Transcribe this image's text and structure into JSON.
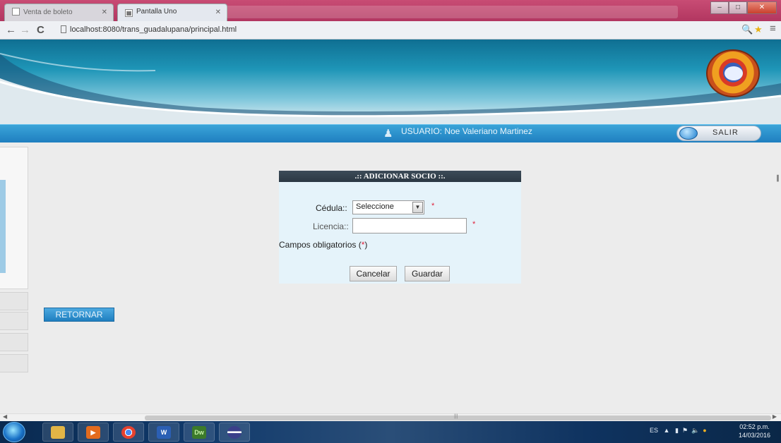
{
  "browser": {
    "tabs": [
      {
        "label": "Venta de boleto",
        "active": false
      },
      {
        "label": "Pantalla Uno",
        "active": true
      }
    ],
    "address": "localhost:8080/trans_guadalupana/principal.html",
    "nav": {
      "back": "←",
      "forward": "→",
      "reload": "C"
    },
    "tools": {
      "zoom": "🔍",
      "bookmark": "★",
      "menu": "≡"
    },
    "window": {
      "minimize": "–",
      "maximize": "□",
      "close": "✕"
    }
  },
  "userbar": {
    "text": "USUARIO:  Noe Valeriano Martinez",
    "logout_label": "SALIR"
  },
  "form": {
    "title": ".:: ADICIONAR SOCIO ::.",
    "cedula_label": "Cédula::",
    "cedula_value": "Seleccione",
    "licencia_label": "Licencia::",
    "licencia_value": "",
    "required_mark": "*",
    "required_note_prefix": "Campos obligatorios (",
    "required_note_suffix": ")",
    "cancel_label": "Cancelar",
    "save_label": "Guardar"
  },
  "retornar_label": "RETORNAR",
  "taskbar": {
    "language": "ES",
    "time": "02:52 p.m.",
    "date": "14/03/2016"
  },
  "colors": {
    "userbar": "#1f7fc0",
    "form_title_bg": "#2b3843",
    "form_bg": "#e5f3fa",
    "required": "#e0203a"
  }
}
